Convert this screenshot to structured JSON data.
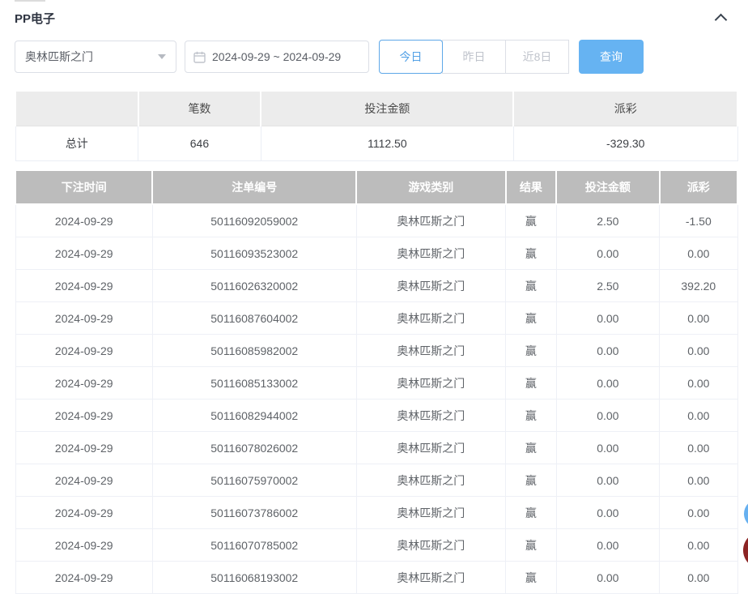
{
  "panel": {
    "title": "PP电子",
    "collapse_icon": "chevron-up"
  },
  "filters": {
    "game_select": {
      "value": "奥林匹斯之门",
      "caret_icon": "caret-down"
    },
    "date_range": {
      "value": "2024-09-29 ~ 2024-09-29",
      "icon": "calendar"
    },
    "quick_buttons": [
      {
        "label": "今日",
        "active": true
      },
      {
        "label": "昨日",
        "active": false
      },
      {
        "label": "近8日",
        "active": false
      }
    ],
    "search_label": "查询"
  },
  "summary": {
    "headers": {
      "blank": "",
      "count": "笔数",
      "bet_amount": "投注金额",
      "payout": "派彩"
    },
    "total": {
      "label": "总计",
      "count": "646",
      "bet_amount": "1112.50",
      "payout": "-329.30",
      "payout_negative": true
    }
  },
  "table": {
    "headers": {
      "time": "下注时间",
      "bet_no": "注单编号",
      "game": "游戏类别",
      "result": "结果",
      "amount": "投注金额",
      "payout": "派彩"
    },
    "rows": [
      {
        "date": "2024-09-29",
        "bet_no": "50116092059002",
        "game": "奥林匹斯之门",
        "result": "赢",
        "amount": "2.50",
        "payout": "-1.50",
        "payout_negative": true
      },
      {
        "date": "2024-09-29",
        "bet_no": "50116093523002",
        "game": "奥林匹斯之门",
        "result": "赢",
        "amount": "0.00",
        "payout": "0.00",
        "payout_negative": false
      },
      {
        "date": "2024-09-29",
        "bet_no": "50116026320002",
        "game": "奥林匹斯之门",
        "result": "赢",
        "amount": "2.50",
        "payout": "392.20",
        "payout_negative": false
      },
      {
        "date": "2024-09-29",
        "bet_no": "50116087604002",
        "game": "奥林匹斯之门",
        "result": "赢",
        "amount": "0.00",
        "payout": "0.00",
        "payout_negative": false
      },
      {
        "date": "2024-09-29",
        "bet_no": "50116085982002",
        "game": "奥林匹斯之门",
        "result": "赢",
        "amount": "0.00",
        "payout": "0.00",
        "payout_negative": false
      },
      {
        "date": "2024-09-29",
        "bet_no": "50116085133002",
        "game": "奥林匹斯之门",
        "result": "赢",
        "amount": "0.00",
        "payout": "0.00",
        "payout_negative": false
      },
      {
        "date": "2024-09-29",
        "bet_no": "50116082944002",
        "game": "奥林匹斯之门",
        "result": "赢",
        "amount": "0.00",
        "payout": "0.00",
        "payout_negative": false
      },
      {
        "date": "2024-09-29",
        "bet_no": "50116078026002",
        "game": "奥林匹斯之门",
        "result": "赢",
        "amount": "0.00",
        "payout": "0.00",
        "payout_negative": false
      },
      {
        "date": "2024-09-29",
        "bet_no": "50116075970002",
        "game": "奥林匹斯之门",
        "result": "赢",
        "amount": "0.00",
        "payout": "0.00",
        "payout_negative": false
      },
      {
        "date": "2024-09-29",
        "bet_no": "50116073786002",
        "game": "奥林匹斯之门",
        "result": "赢",
        "amount": "0.00",
        "payout": "0.00",
        "payout_negative": false
      },
      {
        "date": "2024-09-29",
        "bet_no": "50116070785002",
        "game": "奥林匹斯之门",
        "result": "赢",
        "amount": "0.00",
        "payout": "0.00",
        "payout_negative": false
      },
      {
        "date": "2024-09-29",
        "bet_no": "50116068193002",
        "game": "奥林匹斯之门",
        "result": "赢",
        "amount": "0.00",
        "payout": "0.00",
        "payout_negative": false
      }
    ]
  },
  "colors": {
    "accent_blue": "#66b3f2",
    "active_blue": "#53a1e6",
    "negative_red": "#f56c6c",
    "table_header_gray": "#bcbcbc",
    "summary_header_gray": "#ececec",
    "float_widget_blue": "#66b0f0",
    "float_widget_red": "#8c2424"
  }
}
